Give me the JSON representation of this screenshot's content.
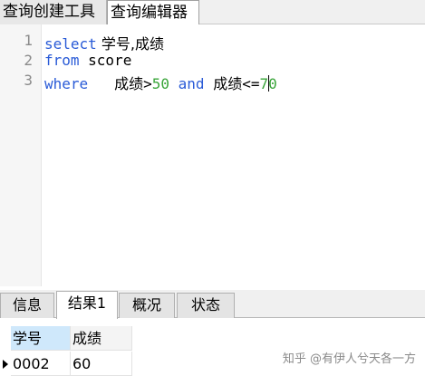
{
  "top_tabs": [
    {
      "label": "查询创建工具",
      "active": false
    },
    {
      "label": "查询编辑器",
      "active": true
    }
  ],
  "editor": {
    "line_numbers": [
      "1",
      "2",
      "3"
    ],
    "lines": [
      {
        "kw1": "select",
        "rest": " 学号,成绩"
      },
      {
        "kw1": "from",
        "rest": " score"
      },
      {
        "kw1": "where",
        "pad": "   ",
        "field1": "成绩",
        "op1": ">",
        "num1": "50",
        "kw2": "and",
        "field2": "成绩",
        "op2": "<=",
        "num2a": "7",
        "num2b": "0"
      }
    ],
    "colors": {
      "keyword": "#2a5bd7",
      "number": "#3aa53a"
    }
  },
  "bottom_tabs": [
    {
      "label": "信息",
      "active": false
    },
    {
      "label": "结果1",
      "active": true
    },
    {
      "label": "概况",
      "active": false
    },
    {
      "label": "状态",
      "active": false
    }
  ],
  "results": {
    "columns": [
      "学号",
      "成绩"
    ],
    "rows": [
      [
        "0002",
        "60"
      ]
    ]
  },
  "watermark": "知乎 @有伊人兮天各一方"
}
